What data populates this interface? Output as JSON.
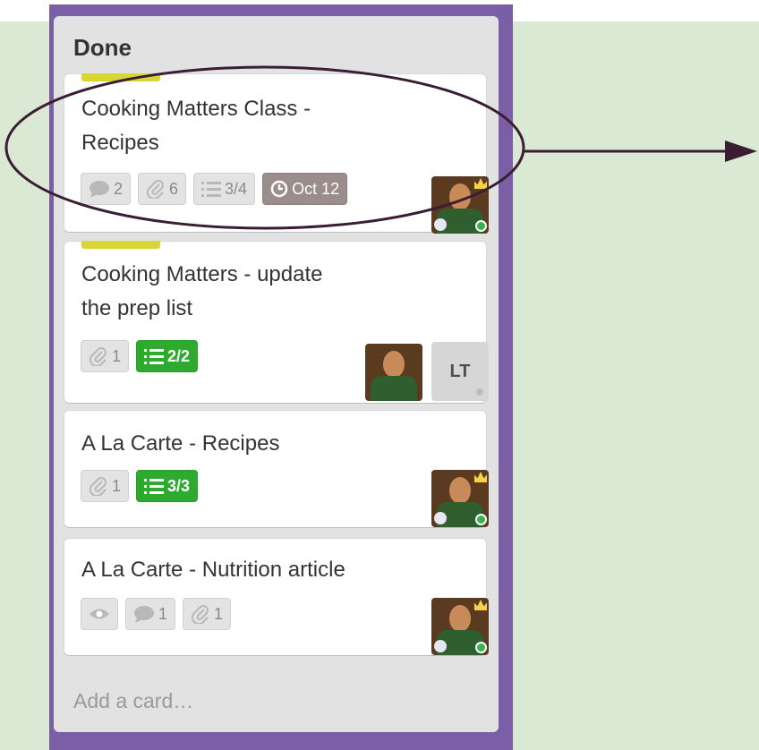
{
  "list": {
    "title": "Done",
    "add_card": "Add a card…"
  },
  "colors": {
    "purple": "#7a5fa6",
    "label_yellow": "#d8d633",
    "check_green": "#2eab2e",
    "due_gray": "#9c8d8d",
    "annotation": "#3a1d33"
  },
  "cards": [
    {
      "title_line1": "Cooking Matters Class -",
      "title_line2": "Recipes",
      "badges": {
        "comments": "2",
        "attachments": "6",
        "checklist": "3/4",
        "due": "Oct 12"
      }
    },
    {
      "title_line1": "Cooking Matters - update",
      "title_line2": "the prep list",
      "badges": {
        "attachments": "1",
        "checklist": "2/2"
      },
      "member_initials": "LT"
    },
    {
      "title_line1": "A La Carte - Recipes",
      "badges": {
        "attachments": "1",
        "checklist": "3/3"
      }
    },
    {
      "title_line1": "A La Carte - Nutrition article",
      "badges": {
        "comments": "1",
        "attachments": "1"
      }
    }
  ]
}
